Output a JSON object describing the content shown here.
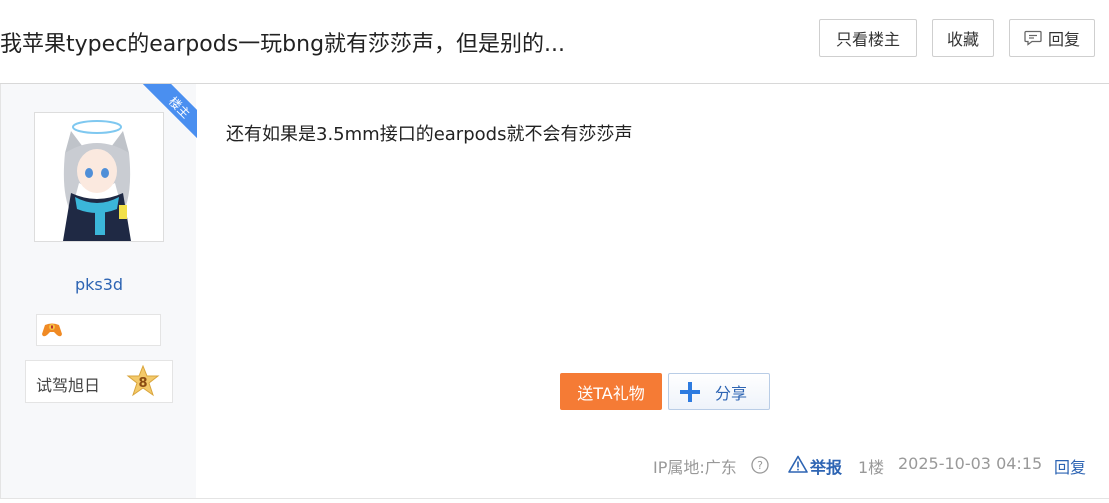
{
  "header": {
    "title": "我苹果typec的earpods一玩bng就有莎莎声，但是别的...",
    "only_author_label": "只看楼主",
    "favorite_label": "收藏",
    "reply_label": "回复"
  },
  "author": {
    "ribbon_label": "楼主",
    "username": "pks3d",
    "level_name": "试驾旭日",
    "level_number": "8"
  },
  "post": {
    "content": "还有如果是3.5mm接口的earpods就不会有莎莎声",
    "gift_label": "送TA礼物",
    "share_label": "分享"
  },
  "meta": {
    "ip": "IP属地:广东",
    "report": "举报",
    "floor": "1楼",
    "time": "2025-10-03 04:15",
    "reply": "回复"
  },
  "colors": {
    "accent_blue": "#2d64b3",
    "ribbon_blue": "#4a8ff0",
    "gift_orange": "#f57b35"
  }
}
